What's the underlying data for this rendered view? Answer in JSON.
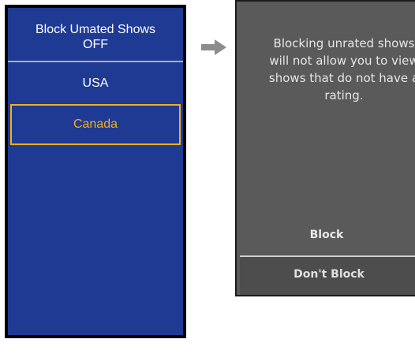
{
  "menu": {
    "block_label": "Block Umated Shows",
    "block_state": "OFF",
    "items": [
      {
        "label": "USA"
      },
      {
        "label": "Canada"
      }
    ],
    "colors": {
      "background": "#1f3a93",
      "highlight": "#f2b01c",
      "text": "#ffffff"
    }
  },
  "arrow_icon": "right-arrow-icon",
  "dialog": {
    "message": "Blocking unrated shows\nwill not allow you to view\nshows that do not have a\nrating.",
    "block_label": "Block",
    "dont_block_label": "Don't Block",
    "colors": {
      "background": "#5a5a5a",
      "text": "#e6e6e6"
    }
  }
}
